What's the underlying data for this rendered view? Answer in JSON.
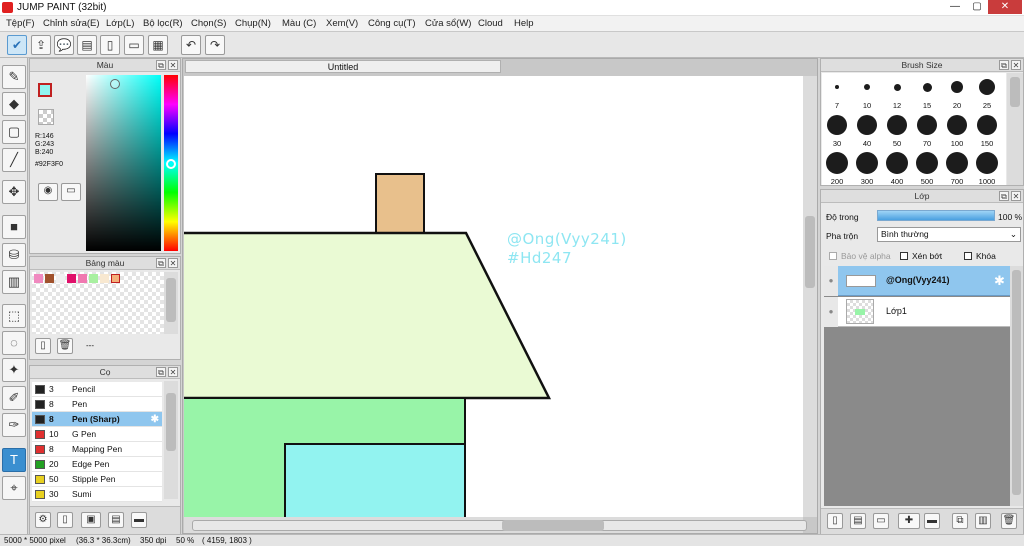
{
  "window": {
    "title": "JUMP PAINT (32bit)",
    "min": "—",
    "max": "▢",
    "close": "✕"
  },
  "menu": [
    "Tệp(F)",
    "Chỉnh sửa(E)",
    "Lớp(L)",
    "Bộ lọc(R)",
    "Chọn(S)",
    "Chụp(N)",
    "Màu (C)",
    "Xem(V)",
    "Công cụ(T)",
    "Cửa sổ(W)",
    "Cloud",
    "Help"
  ],
  "color_panel": {
    "title": "Màu",
    "r": "R:146",
    "g": "G:243",
    "b": "B:240",
    "hex": "#92F3F0",
    "fg_color": "#92F3F0"
  },
  "palette_panel": {
    "title": "Bảng màu",
    "swatches": [
      "#f08ac0",
      "#a0522d",
      "#f0f0f0",
      "#e0106a",
      "#f078b0",
      "#a8f0a0",
      "#f8e8d0",
      "#f4b07a"
    ],
    "footer_text": "---"
  },
  "brush_panel": {
    "title": "Cọ",
    "items": [
      {
        "size": "3",
        "name": "Pencil",
        "color": "#222222"
      },
      {
        "size": "8",
        "name": "Pen",
        "color": "#222222"
      },
      {
        "size": "8",
        "name": "Pen (Sharp)",
        "color": "#222222"
      },
      {
        "size": "10",
        "name": "G Pen",
        "color": "#e03030"
      },
      {
        "size": "8",
        "name": "Mapping Pen",
        "color": "#e03030"
      },
      {
        "size": "20",
        "name": "Edge Pen",
        "color": "#22a022"
      },
      {
        "size": "50",
        "name": "Stipple Pen",
        "color": "#e8d020"
      },
      {
        "size": "30",
        "name": "Sumi",
        "color": "#e8d020"
      }
    ]
  },
  "canvas": {
    "tab": "Untitled",
    "text1": "@Ong(Vyy241)",
    "text2": "#Hd247"
  },
  "brush_size": {
    "title": "Brush Size",
    "sizes": [
      "7",
      "10",
      "12",
      "15",
      "20",
      "25",
      "30",
      "40",
      "50",
      "70",
      "100",
      "150",
      "200",
      "300",
      "400",
      "500",
      "700",
      "1000"
    ]
  },
  "layer_panel": {
    "title": "Lớp",
    "opacity_label": "Độ trong",
    "opacity_value": "100 %",
    "opacity_fraction": 1.0,
    "blend_label": "Pha trộn",
    "blend_value": "Bình thường",
    "protect_alpha": "Bảo vệ alpha",
    "clipping": "Xén bớt",
    "lock": "Khóa",
    "layers": [
      {
        "name": "@Ong(Vyy241)",
        "selected": true
      },
      {
        "name": "Lớp1",
        "selected": false
      }
    ]
  },
  "status": {
    "size": "5000 * 5000 pixel",
    "cm": "(36.3 * 36.3cm)",
    "dpi": "350 dpi",
    "zoom": "50 %",
    "coords": "( 4159, 1803 )"
  }
}
